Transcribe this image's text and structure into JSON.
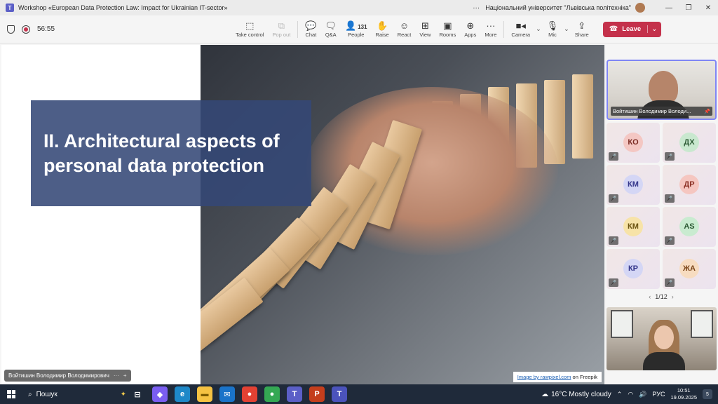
{
  "window": {
    "title": "Workshop «European Data Protection Law: Impact for Ukrainian IT-sector»",
    "more": "···",
    "org": "Національний університет \"Львівська політехніка\"",
    "minimize": "—",
    "restore": "❐",
    "close": "✕"
  },
  "meeting": {
    "timer": "56:55",
    "buttons": {
      "take_control": "Take control",
      "pop_out": "Pop out",
      "chat": "Chat",
      "qa": "Q&A",
      "people": "People",
      "people_count": "131",
      "raise": "Raise",
      "react": "React",
      "view": "View",
      "rooms": "Rooms",
      "apps": "Apps",
      "more": "More",
      "camera": "Camera",
      "mic": "Mic",
      "share": "Share",
      "leave": "Leave"
    }
  },
  "slide": {
    "title": "II. Architectural aspects of personal data protection",
    "credit_link": "Image by rawpixel.com",
    "credit_rest": " on Freepik",
    "presenter": "Войтишин Володимир Володимирович"
  },
  "participants": {
    "speaker_name": "Войтишин Володимир Володи...",
    "tiles": [
      {
        "initials": "КО",
        "color": "#f4c7c3",
        "text": "#7a2a22"
      },
      {
        "initials": "ДХ",
        "color": "#c9e8cf",
        "text": "#2c5a34"
      },
      {
        "initials": "КМ",
        "color": "#d4d6f5",
        "text": "#33358a"
      },
      {
        "initials": "ДР",
        "color": "#f5c6c0",
        "text": "#8a2e22"
      },
      {
        "initials": "КМ",
        "color": "#f7e3a8",
        "text": "#6b5310"
      },
      {
        "initials": "AS",
        "color": "#c9ebd0",
        "text": "#2c5a34"
      },
      {
        "initials": "КР",
        "color": "#d4d6f5",
        "text": "#33358a"
      },
      {
        "initials": "ЖА",
        "color": "#f7dcc0",
        "text": "#7a4416"
      }
    ],
    "pager": "1/12"
  },
  "taskbar": {
    "search": "Пошук",
    "weather": "16°C  Mostly cloudy",
    "lang": "РУС",
    "time": "10:51",
    "date": "19.09.2025",
    "notifications": "5"
  },
  "colors": {
    "accent": "#5b5fc7",
    "leave": "#c4314b",
    "slide_box": "#344876"
  }
}
